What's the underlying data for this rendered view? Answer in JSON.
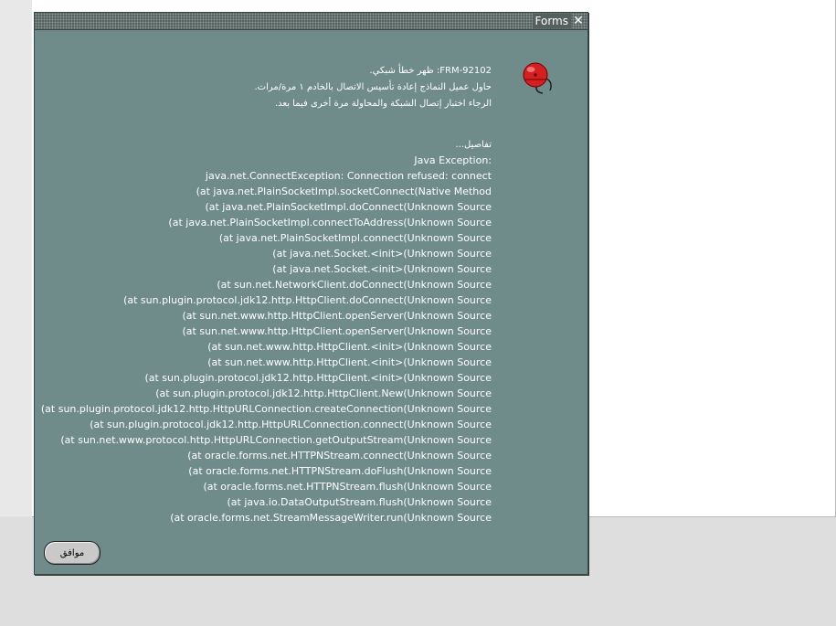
{
  "dialog": {
    "title": "Forms",
    "message_lines": [
      "FRM-92102: ظهر خطأ شبكي.",
      "حاول عميل النماذج إعادة تأسيس الاتصال بالخادم ١ مرة/مرات.",
      "الرجاء اختبار إتصال الشبكة والمحاولة مرة أخرى فيما بعد."
    ],
    "details_label": "تفاصيل...",
    "exception_label": "Java Exception:",
    "stack_lines": [
      "java.net.ConnectException: Connection refused: connect",
      "(at java.net.PlainSocketImpl.socketConnect(Native Method",
      "(at java.net.PlainSocketImpl.doConnect(Unknown Source",
      "(at java.net.PlainSocketImpl.connectToAddress(Unknown Source",
      "(at java.net.PlainSocketImpl.connect(Unknown Source",
      "(at java.net.Socket.<init>(Unknown Source",
      "(at java.net.Socket.<init>(Unknown Source",
      "(at sun.net.NetworkClient.doConnect(Unknown Source",
      "(at sun.plugin.protocol.jdk12.http.HttpClient.doConnect(Unknown Source",
      "(at sun.net.www.http.HttpClient.openServer(Unknown Source",
      "(at sun.net.www.http.HttpClient.openServer(Unknown Source",
      "(at sun.net.www.http.HttpClient.<init>(Unknown Source",
      "(at sun.net.www.http.HttpClient.<init>(Unknown Source",
      "(at sun.plugin.protocol.jdk12.http.HttpClient.<init>(Unknown Source",
      "(at sun.plugin.protocol.jdk12.http.HttpClient.New(Unknown Source",
      "(at sun.plugin.protocol.jdk12.http.HttpURLConnection.createConnection(Unknown Source",
      "(at sun.plugin.protocol.jdk12.http.HttpURLConnection.connect(Unknown Source",
      "(at sun.net.www.protocol.http.HttpURLConnection.getOutputStream(Unknown Source",
      "(at oracle.forms.net.HTTPNStream.connect(Unknown Source",
      "(at oracle.forms.net.HTTPNStream.doFlush(Unknown Source",
      "(at oracle.forms.net.HTTPNStream.flush(Unknown Source",
      "(at java.io.DataOutputStream.flush(Unknown Source",
      "(at oracle.forms.net.StreamMessageWriter.run(Unknown Source"
    ],
    "ok_label": "موافق",
    "icon": "alarm-bell-icon",
    "close_icon": "close-icon"
  },
  "colors": {
    "dialog_background": "#6f8c8b",
    "titlebar": "#55615f",
    "text": "#ffffff",
    "button": "#c9c9c9",
    "icon_red": "#d42020"
  }
}
